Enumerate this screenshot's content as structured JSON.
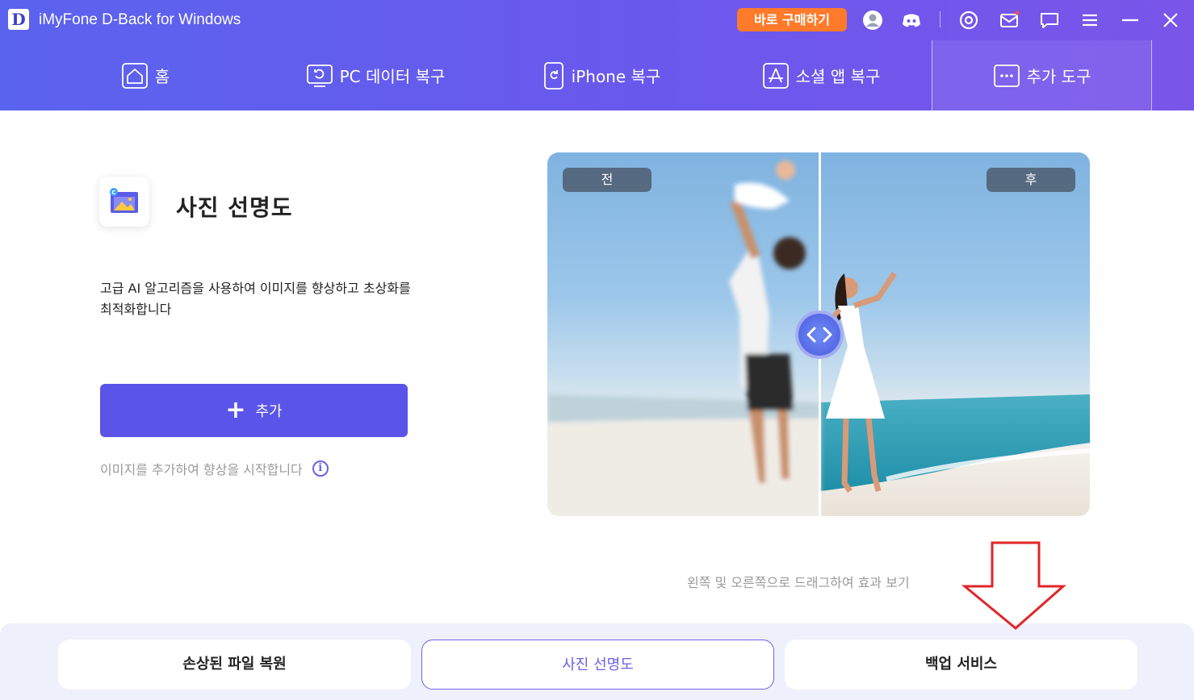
{
  "app": {
    "logo_letter": "D",
    "title": "iMyFone D-Back for Windows",
    "buy_label": "바로 구매하기"
  },
  "titlebar_icons": [
    "user-icon",
    "discord-icon",
    "settings-icon",
    "mail-icon",
    "chat-icon",
    "menu-icon",
    "minimize-icon",
    "close-icon"
  ],
  "nav": {
    "items": [
      {
        "label": "홈",
        "icon": "home-icon"
      },
      {
        "label": "PC 데이터 복구",
        "icon": "pc-recovery-icon"
      },
      {
        "label": "iPhone 복구",
        "icon": "iphone-recovery-icon"
      },
      {
        "label": "소셜 앱 복구",
        "icon": "social-app-icon"
      },
      {
        "label": "추가 도구",
        "icon": "more-tools-icon"
      }
    ],
    "active_index": 4
  },
  "feature": {
    "icon": "photo-enhance-icon",
    "title": "사진 선명도",
    "description": "고급 AI 알고리즘을 사용하여 이미지를 향상하고 초상화를 최적화합니다",
    "add_label": "추가",
    "hint": "이미지를 추가하여 향상을 시작합니다",
    "info_glyph": "i"
  },
  "compare": {
    "before_label": "전",
    "after_label": "후",
    "drag_hint": "왼쪽 및 오른쪽으로 드래그하여 효과 보기"
  },
  "bottom_tabs": [
    {
      "label": "손상된 파일 복원"
    },
    {
      "label": "사진 선명도"
    },
    {
      "label": "백업 서비스"
    }
  ],
  "colors": {
    "header_start": "#5a63ee",
    "header_end": "#7a55ea",
    "accent": "#5a55e8",
    "buy": "#ff7a2a",
    "arrow": "#e0262a"
  }
}
